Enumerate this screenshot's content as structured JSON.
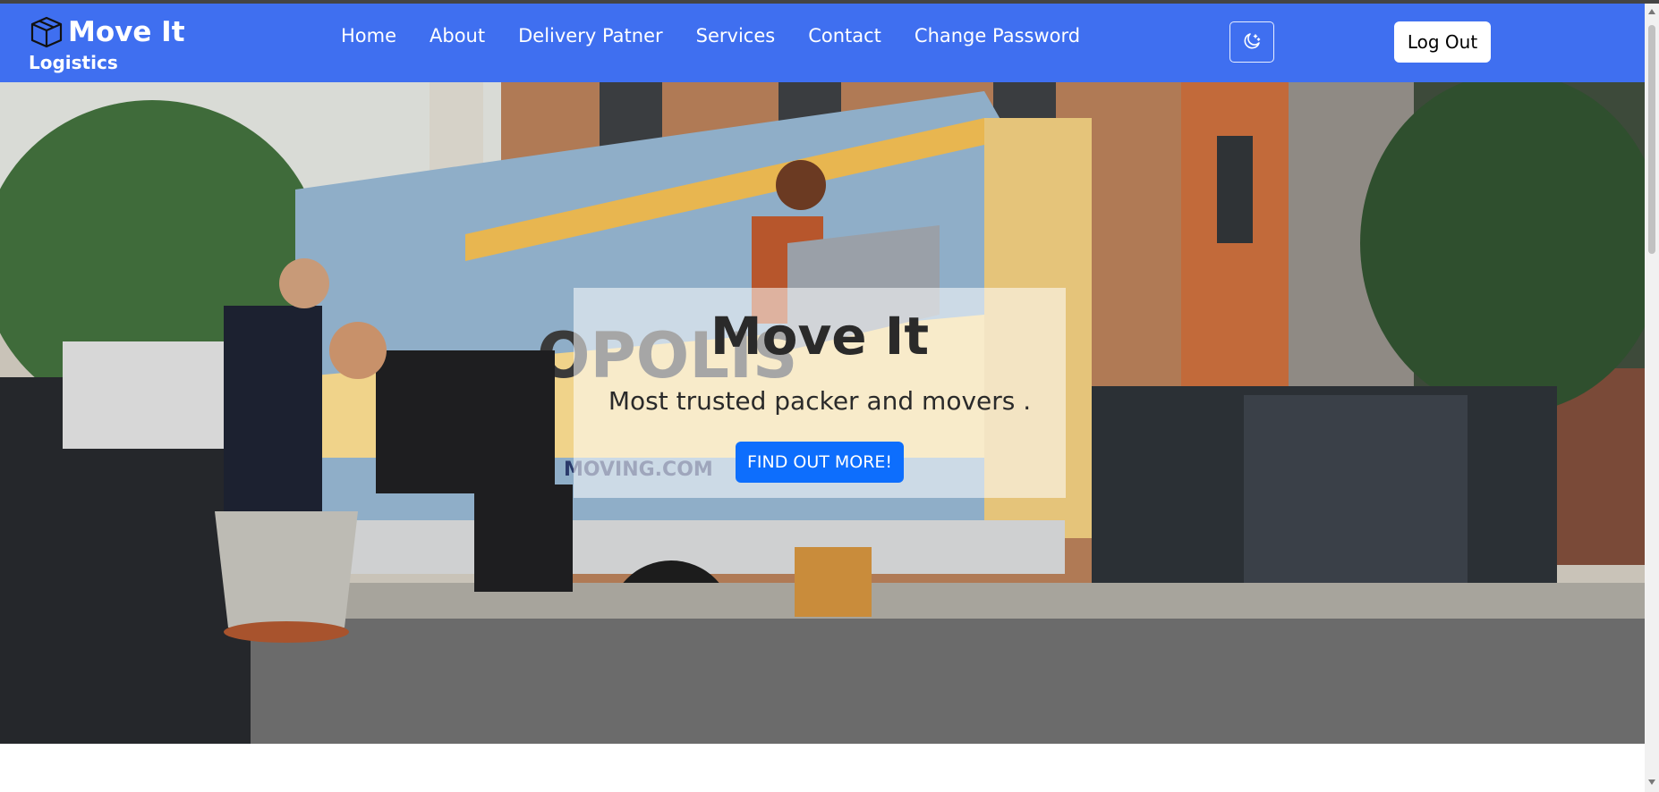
{
  "brand": {
    "title": "Move It",
    "subtitle": "Logistics",
    "icon": "box-icon"
  },
  "nav": {
    "items": [
      {
        "label": "Home"
      },
      {
        "label": "About"
      },
      {
        "label": "Delivery Patner"
      },
      {
        "label": "Services"
      },
      {
        "label": "Contact"
      },
      {
        "label": "Change Password"
      }
    ],
    "theme_toggle_icon": "moon-icon",
    "logout_label": "Log Out"
  },
  "hero": {
    "title": "Move It",
    "subtitle": "Most trusted packer and movers .",
    "cta_label": "FIND OUT MORE!",
    "image": "moving-truck-photo"
  },
  "colors": {
    "navbar": "#3f6ff0",
    "cta": "#0d6efd"
  }
}
